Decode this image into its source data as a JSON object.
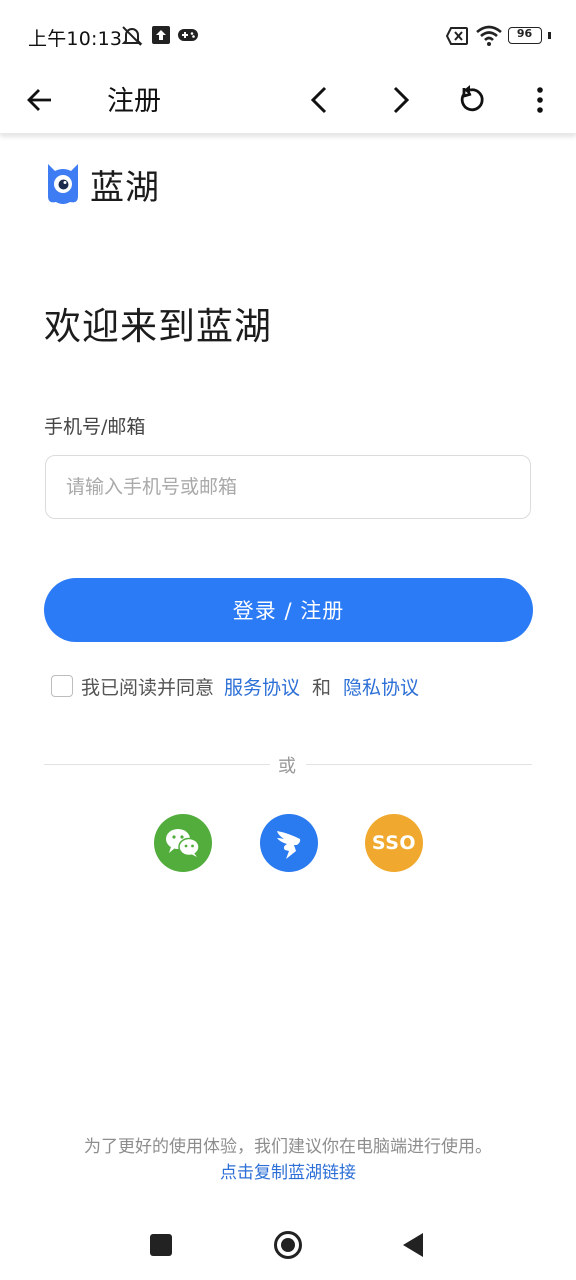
{
  "status_bar": {
    "time": "上午10:13",
    "battery": "96"
  },
  "nav": {
    "title": "注册"
  },
  "logo": {
    "text": "蓝湖",
    "color": "#3d7cf3"
  },
  "welcome_heading": "欢迎来到蓝湖",
  "form": {
    "account_label": "手机号/邮箱",
    "account_placeholder": "请输入手机号或邮箱",
    "account_value": "",
    "submit_label": "登录 / 注册"
  },
  "agreement": {
    "prefix": "我已阅读并同意",
    "service_link": "服务协议",
    "and": "和",
    "privacy_link": "隐私协议",
    "checked": false
  },
  "divider_text": "或",
  "social": {
    "wechat_icon": "wechat-icon",
    "dingtalk_icon": "dingtalk-icon",
    "sso_label": "SSO"
  },
  "footer": {
    "tip": "为了更好的使用体验，我们建议你在电脑端进行使用。",
    "copy_link": "点击复制蓝湖链接"
  },
  "colors": {
    "primary": "#2b7bf7",
    "link": "#2c6fd6",
    "wechat": "#52ad3d",
    "dingtalk": "#2a7af0",
    "sso": "#f0a92e"
  }
}
